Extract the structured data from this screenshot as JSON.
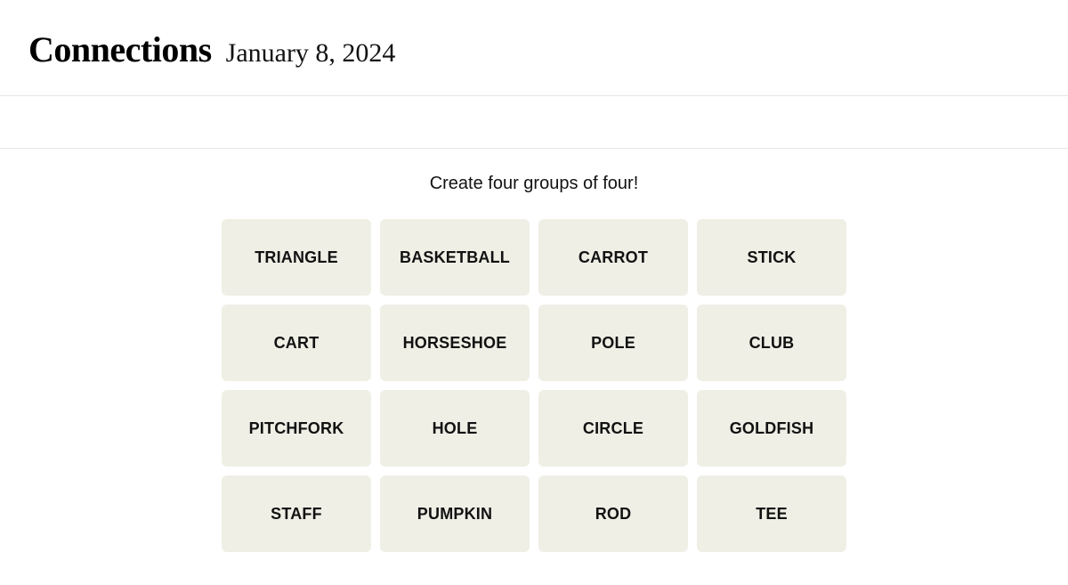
{
  "header": {
    "title": "Connections",
    "date": "January 8, 2024"
  },
  "game": {
    "instructions": "Create four groups of four!",
    "tiles": [
      "TRIANGLE",
      "BASKETBALL",
      "CARROT",
      "STICK",
      "CART",
      "HORSESHOE",
      "POLE",
      "CLUB",
      "PITCHFORK",
      "HOLE",
      "CIRCLE",
      "GOLDFISH",
      "STAFF",
      "PUMPKIN",
      "ROD",
      "TEE"
    ]
  }
}
